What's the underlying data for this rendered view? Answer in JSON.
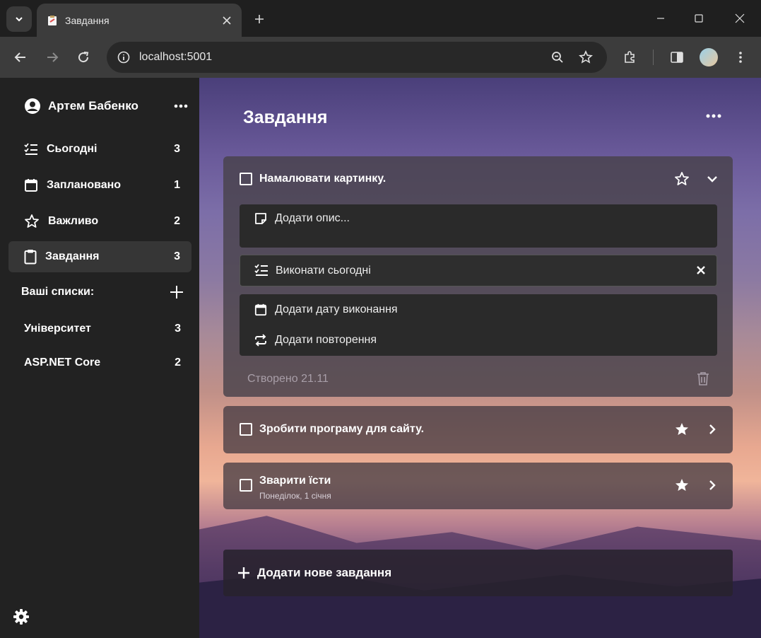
{
  "browser": {
    "tab_title": "Завдання",
    "url": "localhost:5001"
  },
  "sidebar": {
    "user_name": "Артем Бабенко",
    "nav": [
      {
        "label": "Сьогодні",
        "count": "3"
      },
      {
        "label": "Заплановано",
        "count": "1"
      },
      {
        "label": "Важливо",
        "count": "2"
      },
      {
        "label": "Завдання",
        "count": "3"
      }
    ],
    "lists_header": "Ваші списки:",
    "lists": [
      {
        "label": "Університет",
        "count": "3"
      },
      {
        "label": "ASP.NET Core",
        "count": "2"
      }
    ]
  },
  "main": {
    "title": "Завдання",
    "expanded_task": {
      "title": "Намалювати картинку.",
      "description_placeholder": "Додати опис...",
      "my_day": "Виконати сьогодні",
      "add_due_date": "Додати дату виконання",
      "add_repeat": "Додати повторення",
      "created": "Створено 21.11"
    },
    "tasks": [
      {
        "title": "Зробити програму для сайту.",
        "subtitle": ""
      },
      {
        "title": "Зварити їсти",
        "subtitle": "Понеділок, 1 січня"
      }
    ],
    "add_task_label": "Додати нове завдання"
  },
  "colors": {
    "sidebar_bg": "#222222",
    "active_nav_bg": "#363636",
    "chrome_bg": "#3c3c3c"
  }
}
